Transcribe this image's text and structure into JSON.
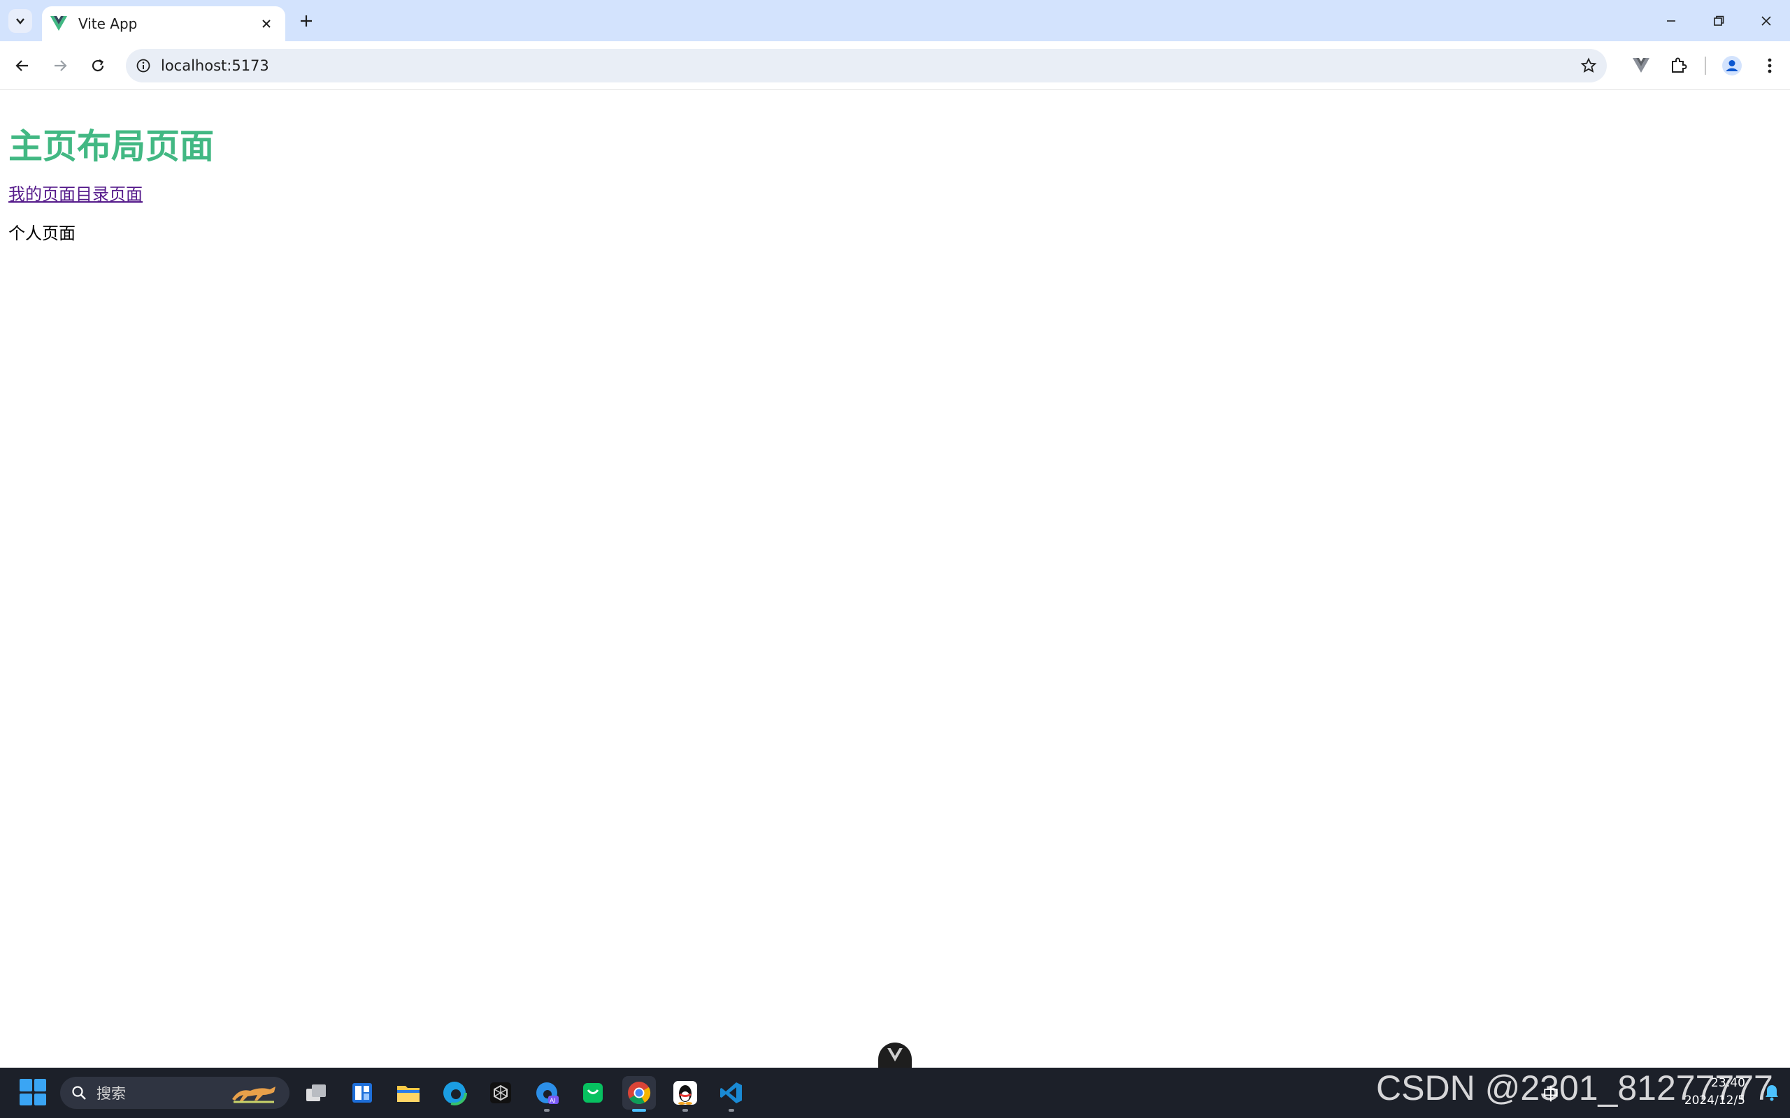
{
  "browser": {
    "tab_title": "Vite App",
    "url": "localhost:5173"
  },
  "page": {
    "heading": "主页布局页面",
    "link_text": "我的页面目录页面",
    "paragraph": "个人页面"
  },
  "taskbar": {
    "search_label": "搜索",
    "time": "23:40",
    "date": "2024/12/5",
    "ime": "中",
    "watermark": "CSDN @2301_81277777"
  },
  "colors": {
    "heading": "#42b883",
    "link": "#551a8b",
    "tabstrip": "#d3e3fd"
  }
}
